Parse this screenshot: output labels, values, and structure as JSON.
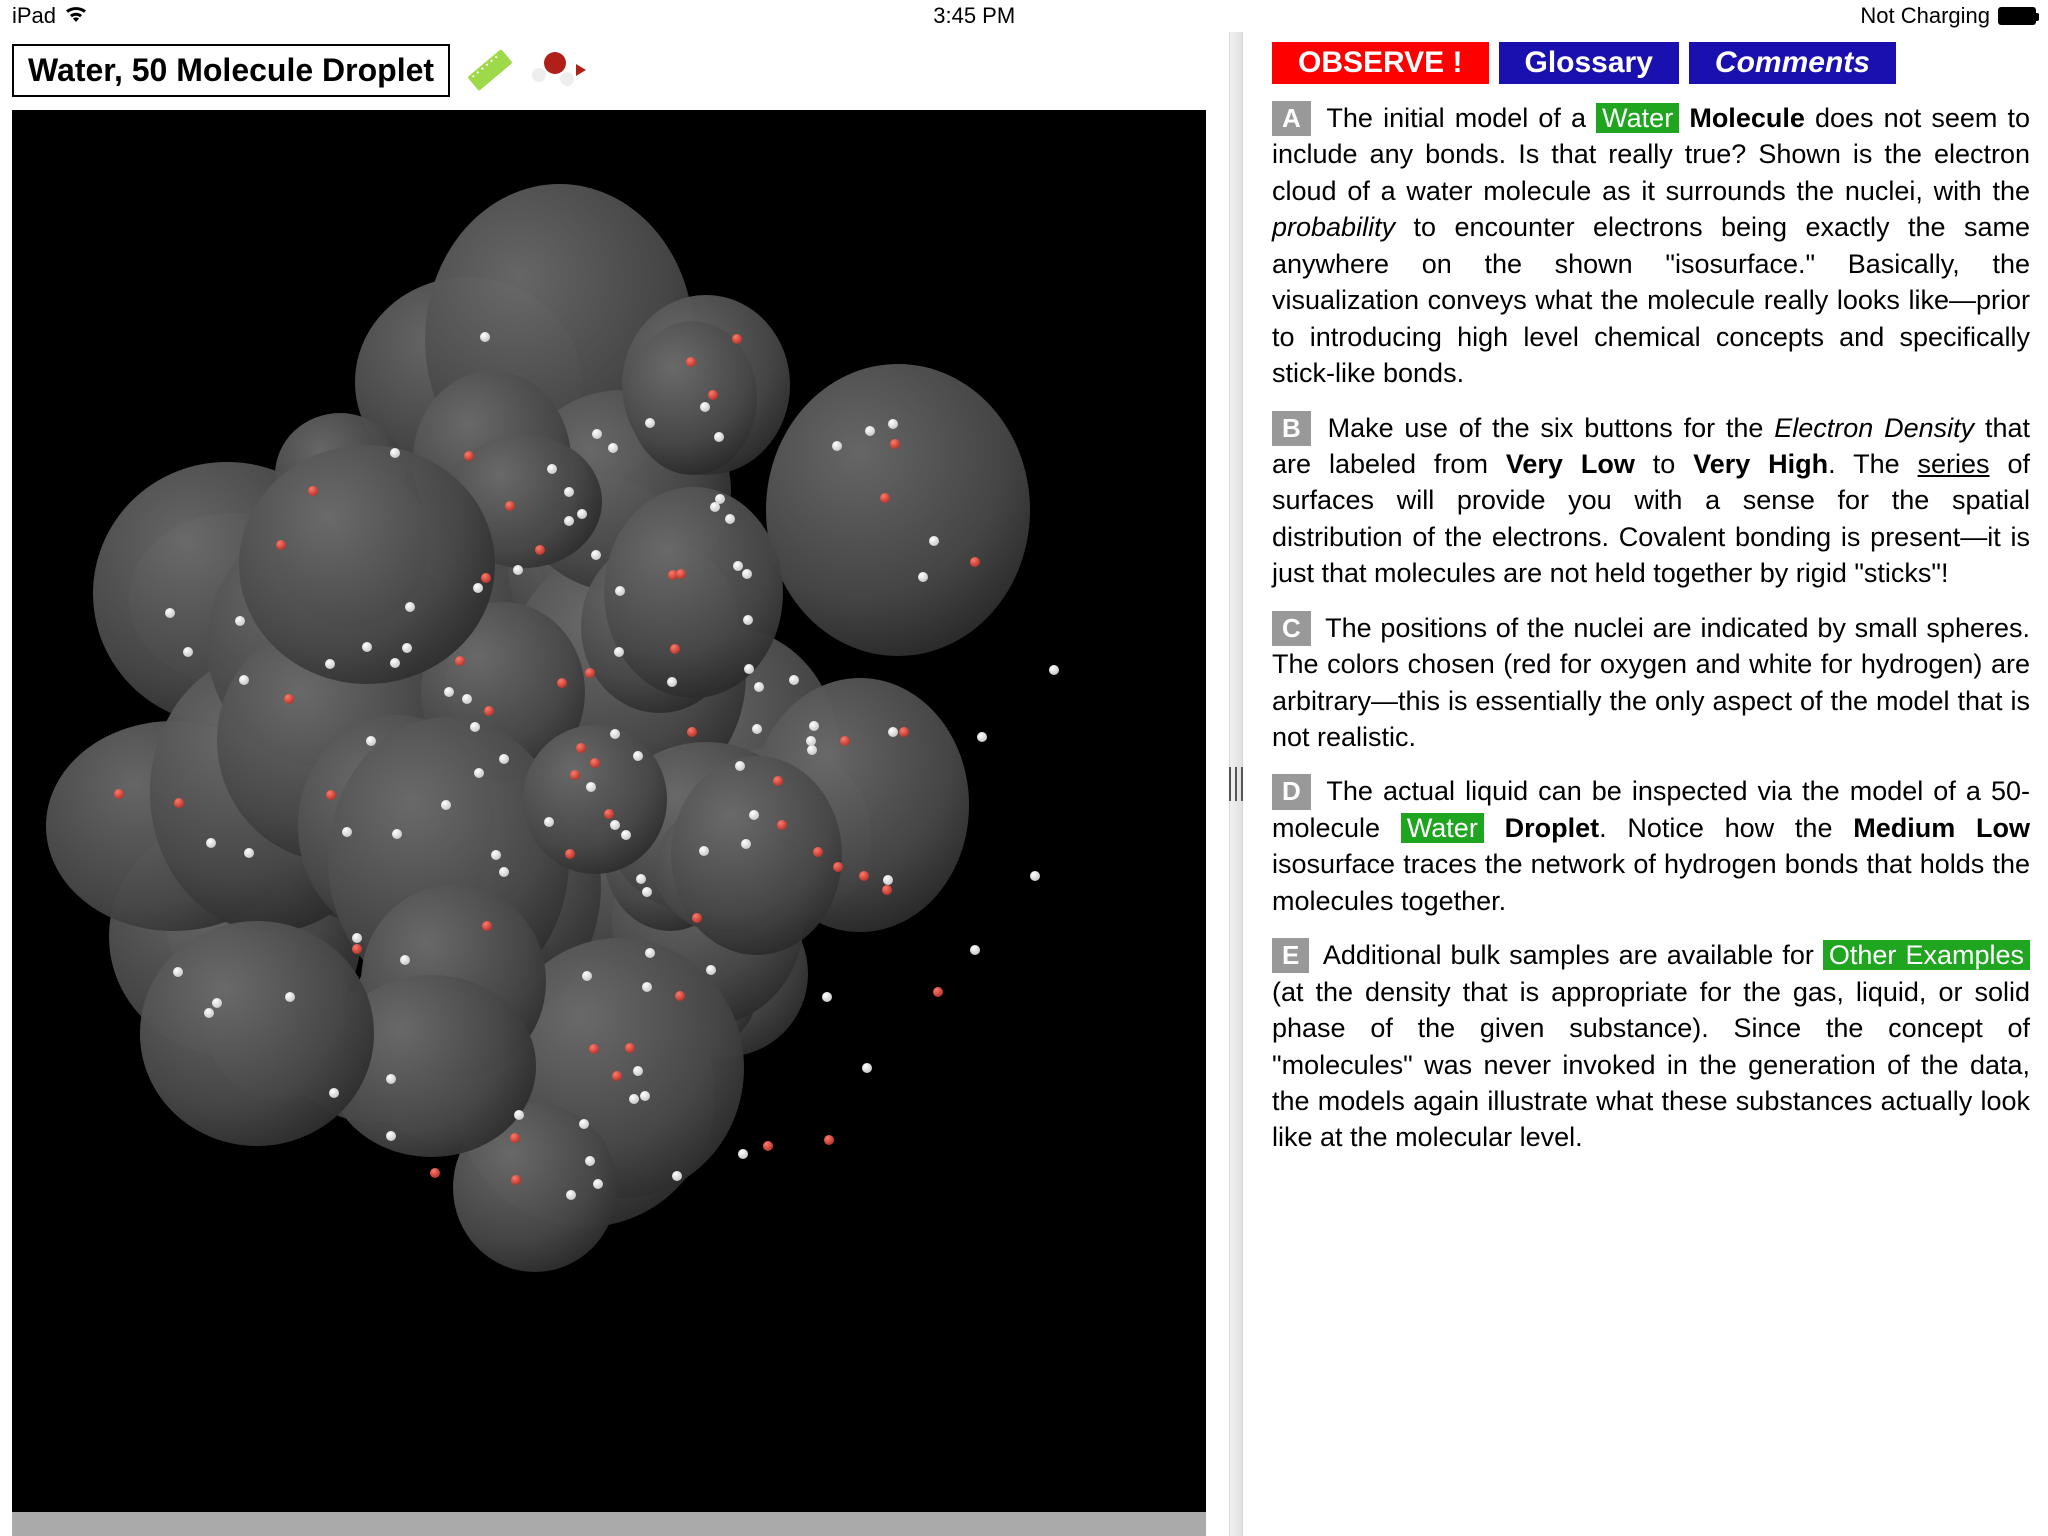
{
  "status": {
    "device": "iPad",
    "time": "3:45 PM",
    "charge": "Not Charging"
  },
  "title": "Water, 50 Molecule Droplet",
  "tabs": {
    "observe": "OBSERVE !",
    "glossary": "Glossary",
    "comments": "Comments"
  },
  "labels": {
    "a": "A",
    "b": "B",
    "c": "C",
    "d": "D",
    "e": "E"
  },
  "links": {
    "water": "Water",
    "other_examples": "Other  Examples"
  },
  "para": {
    "a_1": " The initial model of a ",
    "a_mol": "Molecule",
    "a_2": " does not seem to include any bonds. Is that really true? Shown is the electron cloud of a water molecule as it surrounds the nuclei, with the ",
    "a_prob": "probability",
    "a_3": " to encounter electrons being exactly the same anywhere on the shown \"isosurface.\" Basically, the visualization conveys what the molecule really looks like—prior to introducing high level chemical concepts and specifically stick-like bonds.",
    "b_1": " Make use of the six buttons for the ",
    "b_ed": "Electron Density",
    "b_2": " that are labeled from ",
    "b_vl": "Very Low",
    "b_3": " to ",
    "b_vh": "Very High",
    "b_4": ". The ",
    "b_series": "series",
    "b_5": " of surfaces will provide you with a sense for the spatial distribution of the electrons. Covalent bonding is present—it is just that molecules are not held together by rigid \"sticks\"!",
    "c": " The positions of the nuclei are indicated by small spheres. The colors chosen (red for oxygen and white for hydrogen) are arbitrary—this is essentially the only aspect of the model that is not realistic.",
    "d_1": " The actual liquid can be inspected via the model of a 50-molecule ",
    "d_drop": "Droplet",
    "d_2": ". Notice how the ",
    "d_ml": "Medium Low",
    "d_3": " isosurface traces the network of hydrogen bonds that holds the molecules together.",
    "e_1": " Additional bulk samples are available for ",
    "e_2": " (at the density that is appropriate for the gas, liquid, or solid phase of the given substance). Since the concept of \"molecules\" was never invoked in the generation of the data, the models again illustrate what these substances actually look like at the molecular level."
  }
}
